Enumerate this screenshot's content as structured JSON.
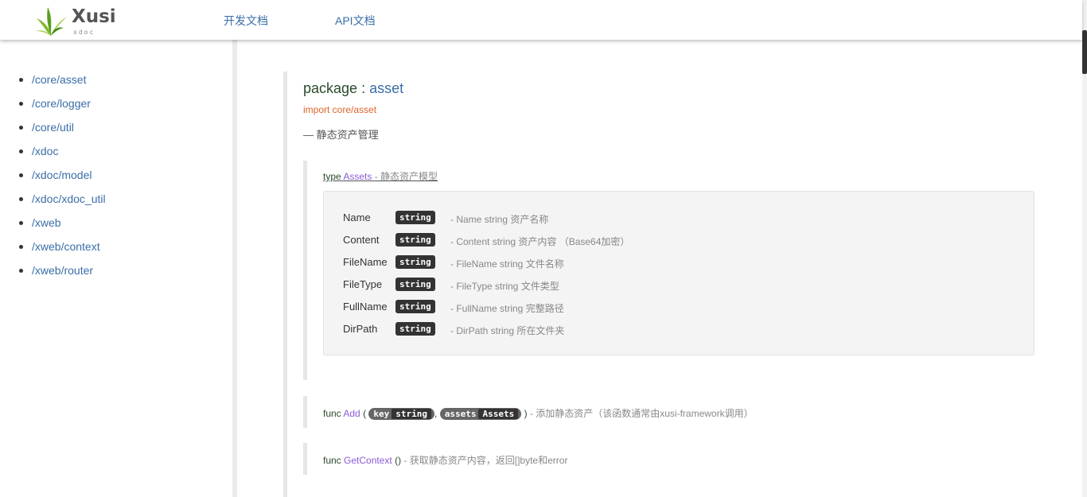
{
  "header": {
    "logo_text": "Xusi",
    "logo_sub": "xdoc",
    "nav": [
      "开发文档",
      "API文档"
    ]
  },
  "sidebar": {
    "items": [
      "/core/asset",
      "/core/logger",
      "/core/util",
      "/xdoc",
      "/xdoc/model",
      "/xdoc/xdoc_util",
      "/xweb",
      "/xweb/context",
      "/xweb/router"
    ]
  },
  "package": {
    "keyword": "package",
    "separator": ":",
    "name": "asset",
    "import": "import core/asset",
    "description": "— 静态资产管理"
  },
  "type": {
    "keyword": "type",
    "name": "Assets",
    "description": "- 静态资产模型",
    "fields": [
      {
        "name": "Name",
        "type": "string",
        "desc": "- Name string 资产名称"
      },
      {
        "name": "Content",
        "type": "string",
        "desc": "- Content string 资产内容 （Base64加密）"
      },
      {
        "name": "FileName",
        "type": "string",
        "desc": "- FileName string 文件名称"
      },
      {
        "name": "FileType",
        "type": "string",
        "desc": "- FileType string 文件类型"
      },
      {
        "name": "FullName",
        "type": "string",
        "desc": "- FullName string 完整路径"
      },
      {
        "name": "DirPath",
        "type": "string",
        "desc": "- DirPath string 所在文件夹"
      }
    ]
  },
  "funcs": [
    {
      "keyword": "func",
      "name": "Add",
      "open": "(",
      "params": [
        {
          "name": "key",
          "type": "string"
        },
        {
          "name": "assets",
          "type": "Assets"
        }
      ],
      "comma": ",",
      "close": ")",
      "desc": "- 添加静态资产（该函数通常由xusi-framework调用）"
    },
    {
      "keyword": "func",
      "name": "GetContext",
      "signature": "()",
      "desc": "- 获取静态资产内容，返回[]byte和error"
    }
  ],
  "colors": {
    "link": "#3a6ea8",
    "import": "#e0622a",
    "func_name": "#8a5cd8",
    "badge": "#333333"
  }
}
